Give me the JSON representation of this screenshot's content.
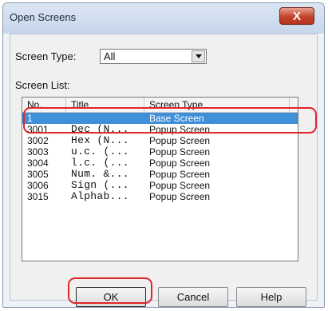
{
  "window": {
    "title": "Open Screens",
    "close_glyph": "X"
  },
  "form": {
    "screen_type_label": "Screen Type:",
    "screen_type_value": "All",
    "screen_list_label": "Screen List:"
  },
  "list": {
    "columns": [
      "No.",
      "Title",
      "Screen Type"
    ],
    "rows": [
      {
        "no": "1",
        "title": "",
        "type": "Base Screen",
        "selected": true
      },
      {
        "no": "3001",
        "title": "Dec (N...",
        "type": "Popup Screen"
      },
      {
        "no": "3002",
        "title": "Hex (N...",
        "type": "Popup Screen"
      },
      {
        "no": "3003",
        "title": "u.c. (...",
        "type": "Popup Screen"
      },
      {
        "no": "3004",
        "title": "l.c. (...",
        "type": "Popup Screen"
      },
      {
        "no": "3005",
        "title": "Num. &...",
        "type": "Popup Screen"
      },
      {
        "no": "3006",
        "title": "Sign (...",
        "type": "Popup Screen"
      },
      {
        "no": "3015",
        "title": "Alphab...",
        "type": "Popup Screen"
      }
    ]
  },
  "buttons": {
    "ok": "OK",
    "cancel": "Cancel",
    "help": "Help"
  },
  "colors": {
    "highlight": "#e0262b",
    "selection": "#3f8fd9"
  }
}
